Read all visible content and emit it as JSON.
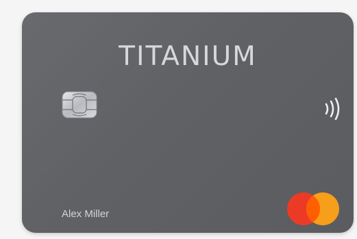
{
  "card": {
    "brand": "TITANIUM",
    "holder_name": "Alex Miller",
    "colors": {
      "card_body": "#5f6165",
      "brand_text": "#d6d8dc",
      "mastercard_red": "#eb3b26",
      "mastercard_orange": "#f79e1b",
      "mastercard_overlap": "#ff5f00"
    },
    "icons": [
      "chip-icon",
      "contactless-icon",
      "mastercard-logo"
    ]
  }
}
